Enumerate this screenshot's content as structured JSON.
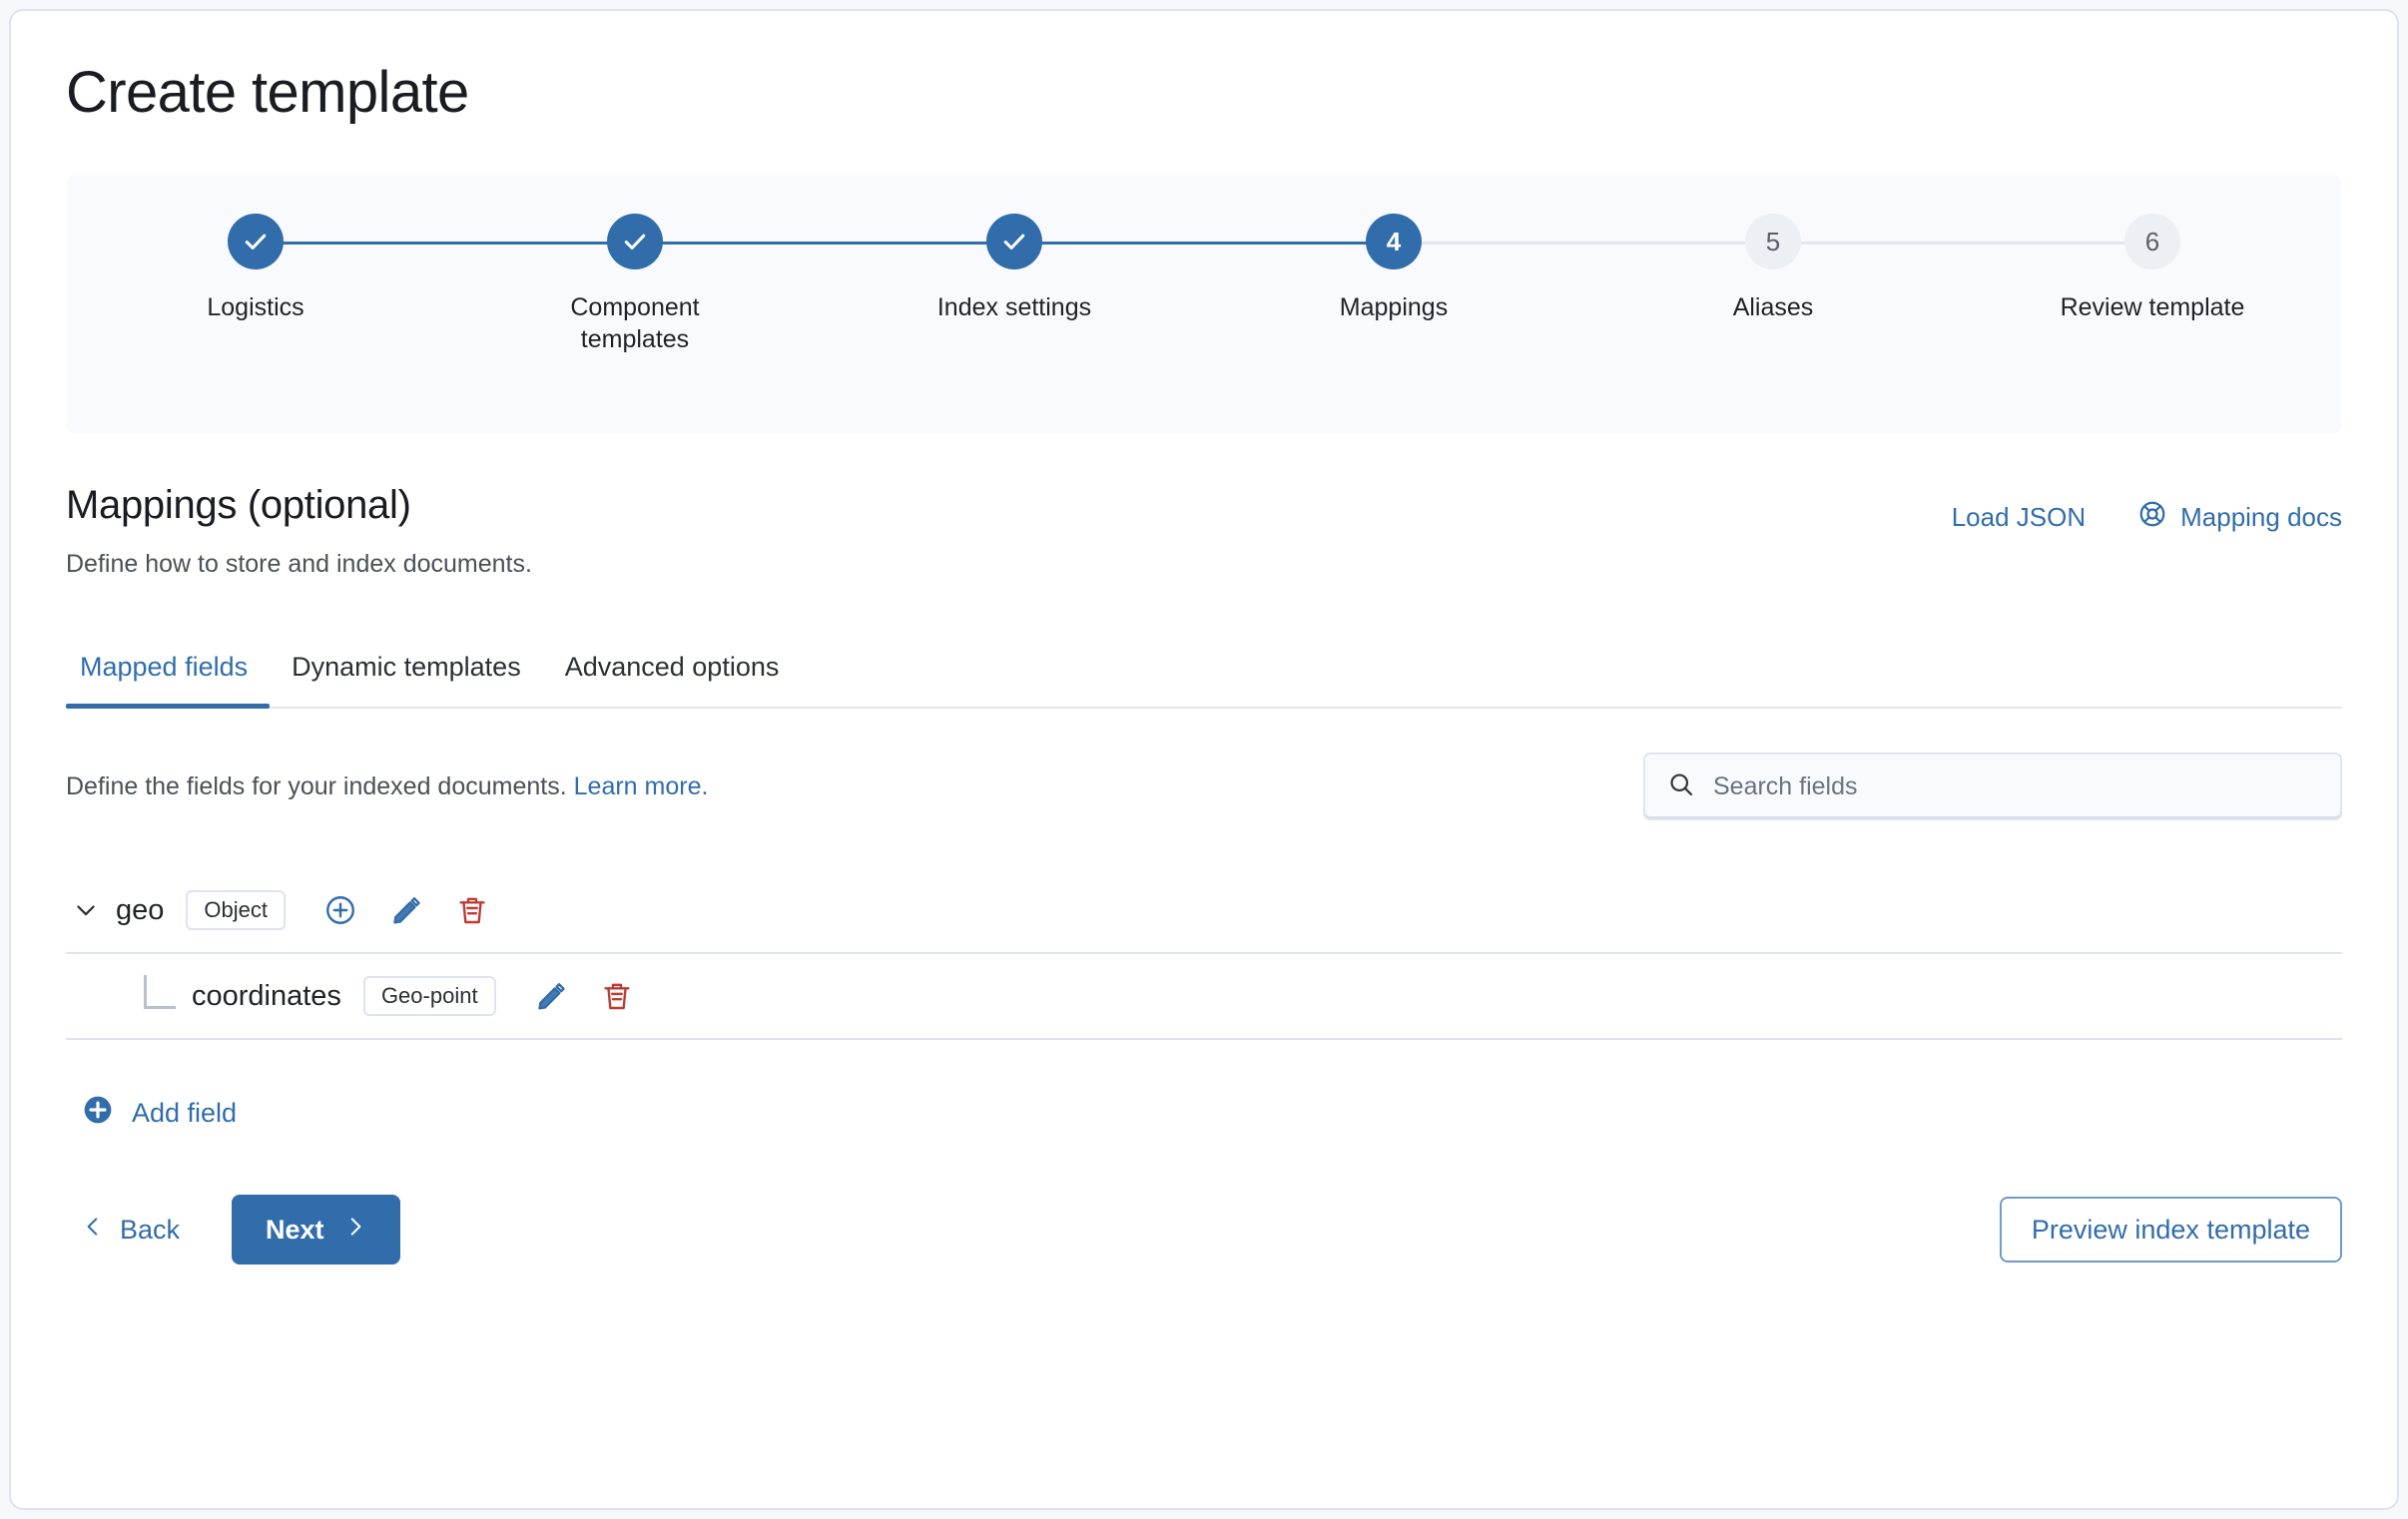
{
  "page": {
    "title": "Create template"
  },
  "stepper": {
    "steps": [
      {
        "number": "1",
        "label": "Logistics",
        "state": "done"
      },
      {
        "number": "2",
        "label": "Component templates",
        "state": "done"
      },
      {
        "number": "3",
        "label": "Index settings",
        "state": "done"
      },
      {
        "number": "4",
        "label": "Mappings",
        "state": "current"
      },
      {
        "number": "5",
        "label": "Aliases",
        "state": "todo"
      },
      {
        "number": "6",
        "label": "Review template",
        "state": "todo"
      }
    ]
  },
  "section": {
    "title": "Mappings (optional)",
    "subtitle": "Define how to store and index documents.",
    "load_json_label": "Load JSON",
    "mapping_docs_label": "Mapping docs",
    "mapping_docs_icon": "lifebuoy-help-icon"
  },
  "tabs": [
    {
      "label": "Mapped fields",
      "active": true
    },
    {
      "label": "Dynamic templates",
      "active": false
    },
    {
      "label": "Advanced options",
      "active": false
    }
  ],
  "mapped_fields": {
    "description": "Define the fields for your indexed documents.",
    "learn_more_label": "Learn more.",
    "search": {
      "placeholder": "Search fields",
      "value": "",
      "icon": "search-icon"
    },
    "fields": [
      {
        "name": "geo",
        "type": "Object",
        "level": 0,
        "expanded": true,
        "actions": [
          "add-icon",
          "edit-icon",
          "delete-icon"
        ]
      },
      {
        "name": "coordinates",
        "type": "Geo-point",
        "level": 1,
        "expanded": false,
        "actions": [
          "edit-icon",
          "delete-icon"
        ]
      }
    ],
    "add_field_label": "Add field"
  },
  "footer": {
    "back_label": "Back",
    "next_label": "Next",
    "preview_label": "Preview index template"
  },
  "colors": {
    "accent": "#316dab",
    "danger": "#bd3c32",
    "panel_bg": "#f8fafd",
    "border": "#dfe3ef",
    "text": "#1a1c21",
    "muted_text": "#4b5059"
  }
}
